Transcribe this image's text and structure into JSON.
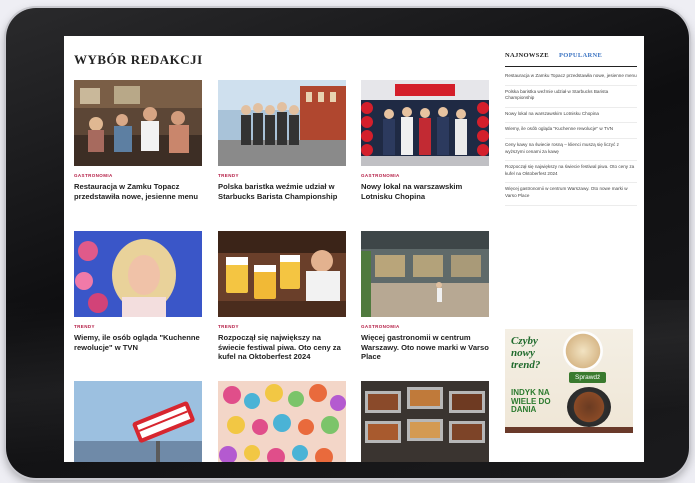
{
  "main": {
    "section_title": "WYBÓR REDAKCJI",
    "articles": [
      {
        "category": "GASTRONOMIA",
        "title": "Restauracja w Zamku Topacz przedstawiła nowe, jesienne menu"
      },
      {
        "category": "TRENDY",
        "title": "Polska baristka weźmie udział w Starbucks Barista Championship"
      },
      {
        "category": "GASTRONOMIA",
        "title": "Nowy lokal na warszawskim Lotnisku Chopina"
      },
      {
        "category": "TRENDY",
        "title": "Wiemy, ile osób ogląda \"Kuchenne rewolucje\" w TVN"
      },
      {
        "category": "TRENDY",
        "title": "Rozpoczął się największy na świecie festiwal piwa. Oto ceny za kufel na Oktoberfest 2024"
      },
      {
        "category": "GASTRONOMIA",
        "title": "Więcej gastronomii w centrum Warszawy. Oto nowe marki w Varso Place"
      },
      {
        "category": "",
        "title": ""
      },
      {
        "category": "",
        "title": ""
      },
      {
        "category": "",
        "title": ""
      }
    ]
  },
  "sidebar": {
    "tab_newest": "NAJNOWSZE",
    "tab_popular": "POPULARNE",
    "items": [
      "Restauracja w Zamku Topacz przedstawiła nowe, jesienne menu",
      "Polska baristka weźmie udział w Starbucks Barista Championship",
      "Nowy lokal na warszawskim Lotnisku Chopina",
      "Wiemy, ile osób ogląda \"Kuchenne rewolucje\" w TVN",
      "Ceny kawy na świecie rosną – klienci muszą się liczyć z wyższymi cenami za kawę",
      "Rozpoczął się największy na świecie festiwal piwa. Oto ceny za kufel na Oktoberfest 2024",
      "Więcej gastronomii w centrum Warszawy. Oto nowe marki w Varso Place"
    ],
    "ad": {
      "question": "Czyby nowy trend?",
      "button": "Sprawdź",
      "headline": "INDYK NA WIELE DO DANIA"
    }
  },
  "colors": {
    "category": "#b31942",
    "tab_active": "#3b73c2",
    "ad_green": "#2b7a2e"
  }
}
